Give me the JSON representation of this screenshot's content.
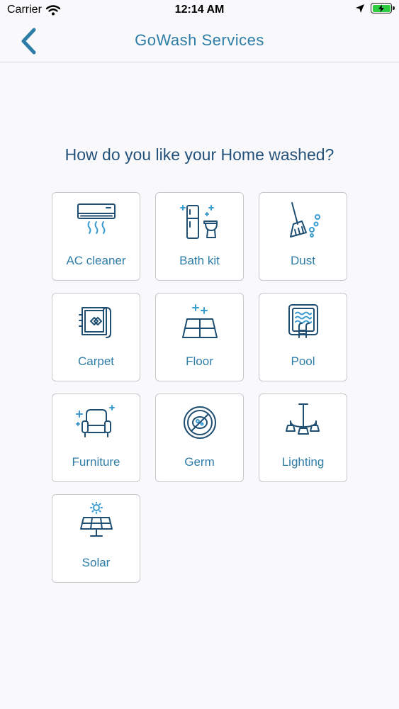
{
  "status_bar": {
    "carrier": "Carrier",
    "time": "12:14 AM"
  },
  "nav": {
    "title": "GoWash Services",
    "back_icon": "chevron-left-icon"
  },
  "question": "How do you like your Home washed?",
  "services": [
    {
      "label": "AC cleaner",
      "icon": "air-conditioner-icon"
    },
    {
      "label": "Bath kit",
      "icon": "bath-kit-icon"
    },
    {
      "label": "Dust",
      "icon": "broom-icon"
    },
    {
      "label": "Carpet",
      "icon": "carpet-icon"
    },
    {
      "label": "Floor",
      "icon": "floor-tiles-icon"
    },
    {
      "label": "Pool",
      "icon": "pool-icon"
    },
    {
      "label": "Furniture",
      "icon": "armchair-icon"
    },
    {
      "label": "Germ",
      "icon": "no-germ-icon"
    },
    {
      "label": "Lighting",
      "icon": "chandelier-icon"
    },
    {
      "label": "Solar",
      "icon": "solar-panel-icon"
    }
  ],
  "colors": {
    "accent": "#2e7da7",
    "heading": "#24527a",
    "icon": "#1f4f72",
    "battery": "#2ecc40"
  }
}
